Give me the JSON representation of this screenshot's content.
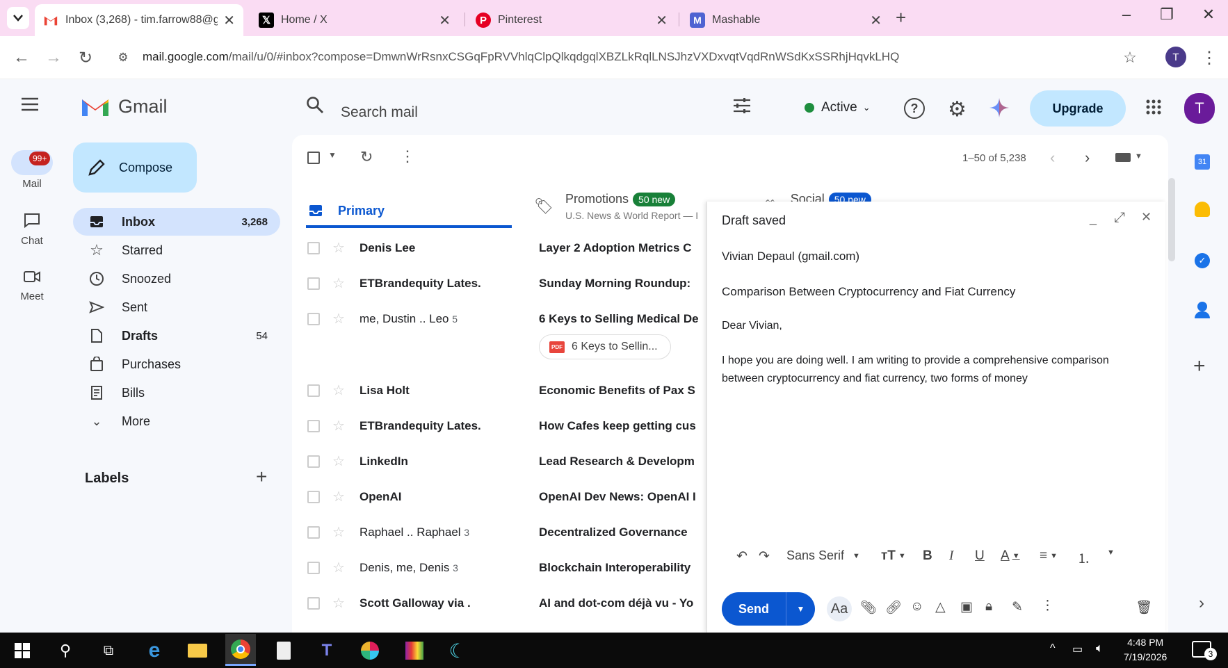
{
  "browser": {
    "tabs": [
      {
        "title": "Inbox (3,268) - tim.farrow88@g",
        "active": true
      },
      {
        "title": "Home / X",
        "active": false
      },
      {
        "title": "Pinterest",
        "active": false
      },
      {
        "title": "Mashable",
        "active": false
      }
    ],
    "url_host": "mail.google.com",
    "url_path": "/mail/u/0/#inbox?compose=DmwnWrRsnxCSGqFpRVVhlqClpQlkqdgqlXBZLkRqlLNSJhzVXDxvqtVqdRnWSdKxSSRhjHqvkLHQ",
    "profile_initial": "T"
  },
  "gmail": {
    "logo_text": "Gmail",
    "search_placeholder": "Search mail",
    "status": "Active",
    "upgrade_label": "Upgrade",
    "avatar_initial": "T",
    "rail": {
      "mail": "Mail",
      "mail_badge": "99+",
      "chat": "Chat",
      "meet": "Meet"
    },
    "compose_label": "Compose",
    "nav": [
      {
        "label": "Inbox",
        "count": "3,268"
      },
      {
        "label": "Starred",
        "count": ""
      },
      {
        "label": "Snoozed",
        "count": ""
      },
      {
        "label": "Sent",
        "count": ""
      },
      {
        "label": "Drafts",
        "count": "54"
      },
      {
        "label": "Purchases",
        "count": ""
      },
      {
        "label": "Bills",
        "count": ""
      },
      {
        "label": "More",
        "count": ""
      }
    ],
    "labels_heading": "Labels",
    "pagination": "1–50 of 5,238",
    "categories": {
      "primary": "Primary",
      "promotions": "Promotions",
      "promotions_badge": "50 new",
      "promotions_sub": "U.S. News & World Report — I",
      "social": "Social",
      "social_badge": "50 new"
    },
    "emails": [
      {
        "sender": "Denis Lee",
        "count": "",
        "subject": "Layer 2 Adoption Metrics C"
      },
      {
        "sender": "ETBrandequity Lates.",
        "count": "",
        "subject": "Sunday Morning Roundup:"
      },
      {
        "sender": "me, Dustin .. Leo",
        "count": "5",
        "subject": "6 Keys to Selling Medical De"
      },
      {
        "sender": "Lisa Holt",
        "count": "",
        "subject": "Economic Benefits of Pax S"
      },
      {
        "sender": "ETBrandequity Lates.",
        "count": "",
        "subject": "How Cafes keep getting cus"
      },
      {
        "sender": "LinkedIn",
        "count": "",
        "subject": "Lead Research & Developm"
      },
      {
        "sender": "OpenAI",
        "count": "",
        "subject": "OpenAI Dev News: OpenAI I"
      },
      {
        "sender": "Raphael .. Raphael",
        "count": "3",
        "subject": "Decentralized Governance"
      },
      {
        "sender": "Denis, me, Denis",
        "count": "3",
        "subject": "Blockchain Interoperability"
      },
      {
        "sender": "Scott Galloway via .",
        "count": "",
        "subject": "AI and dot-com déjà vu - Yo"
      }
    ],
    "attachment_chip": "6 Keys to Sellin...",
    "compose_window": {
      "title": "Draft saved",
      "to": "Vivian Depaul (gmail.com)",
      "subject": "Comparison Between Cryptocurrency and Fiat Currency",
      "greeting": "Dear Vivian,",
      "body_line1": "I hope you are doing well. I am writing to provide a comprehensive comparison",
      "body_line2": "between cryptocurrency and fiat currency, two forms of money",
      "font": "Sans Serif",
      "send_label": "Send"
    }
  },
  "taskbar": {
    "time": "4:48 PM",
    "date": "7/19/2026",
    "notif_count": "3"
  },
  "colors": {
    "tab_bar": "#fadcf3",
    "gmail_red": "#ea4335",
    "primary_blue": "#0b57d0",
    "badge_green": "#188038",
    "badge_blue": "#0b57d0"
  }
}
